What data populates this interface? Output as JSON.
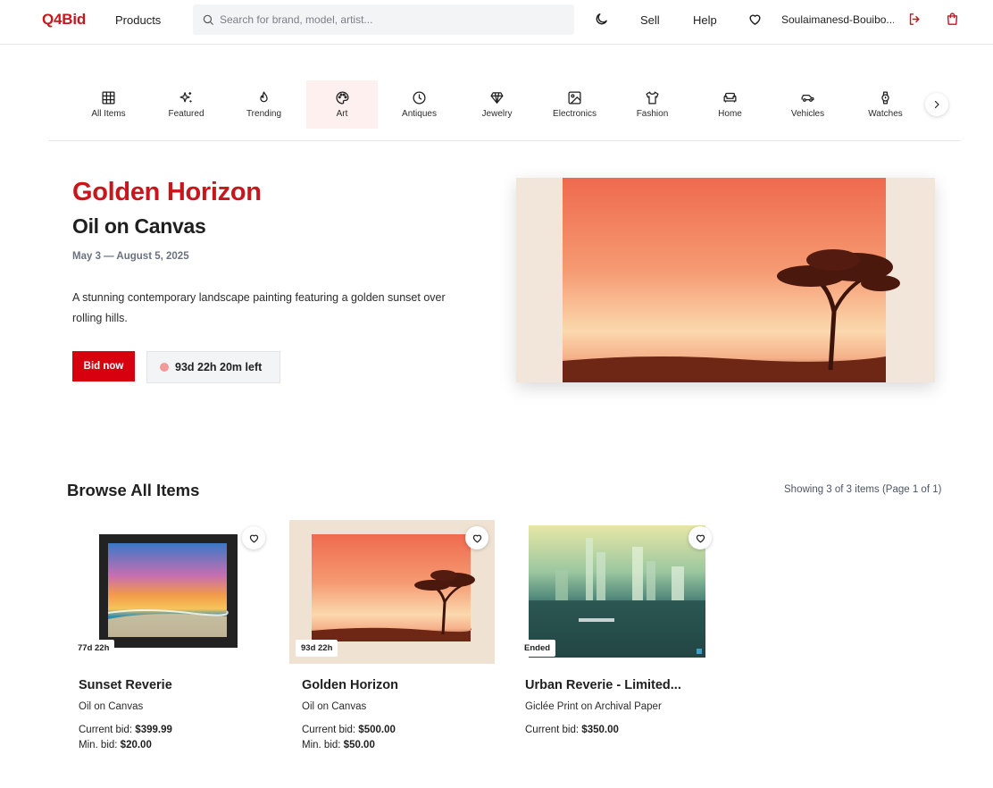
{
  "header": {
    "logo": "Q4Bid",
    "products_label": "Products",
    "search_placeholder": "Search for brand, model, artist...",
    "sell_label": "Sell",
    "help_label": "Help",
    "username": "Soulaimanesd-Bouibo...",
    "icons": [
      "search-icon",
      "moon-icon",
      "heart-icon",
      "logout-icon",
      "shopping-bag-icon"
    ]
  },
  "categories": {
    "items": [
      {
        "label": "All Items",
        "icon": "grid-icon"
      },
      {
        "label": "Featured",
        "icon": "sparkles-icon"
      },
      {
        "label": "Trending",
        "icon": "flame-icon"
      },
      {
        "label": "Art",
        "icon": "palette-icon",
        "active": true
      },
      {
        "label": "Antiques",
        "icon": "clock-icon"
      },
      {
        "label": "Jewelry",
        "icon": "gem-icon"
      },
      {
        "label": "Electronics",
        "icon": "image-icon"
      },
      {
        "label": "Fashion",
        "icon": "shirt-icon"
      },
      {
        "label": "Home",
        "icon": "sofa-icon"
      },
      {
        "label": "Vehicles",
        "icon": "car-icon"
      },
      {
        "label": "Watches",
        "icon": "watch-icon"
      }
    ],
    "next_icon": "chevron-right-icon",
    "active_bg": "#fdf0ef"
  },
  "hero": {
    "title": "Golden Horizon",
    "subtitle": "Oil on Canvas",
    "dates": "May 3 — August 5, 2025",
    "description": "A stunning contemporary landscape painting featuring a golden sunset over rolling hills.",
    "bid_button": "Bid now",
    "time_left": "93d 22h 20m left"
  },
  "browse": {
    "title": "Browse All Items",
    "count_text": "Showing 3 of 3 items (Page 1 of 1)",
    "items": [
      {
        "badge": "77d 22h",
        "title": "Sunset Reverie",
        "medium": "Oil on Canvas",
        "current_bid_label": "Current bid:",
        "current_bid": "$399.99",
        "min_bid_label": "Min. bid:",
        "min_bid": "$20.00"
      },
      {
        "badge": "93d 22h",
        "title": "Golden Horizon",
        "medium": "Oil on Canvas",
        "current_bid_label": "Current bid:",
        "current_bid": "$500.00",
        "min_bid_label": "Min. bid:",
        "min_bid": "$50.00"
      },
      {
        "badge": "Ended",
        "title": "Urban Reverie - Limited...",
        "medium": "Giclée Print on Archival Paper",
        "current_bid_label": "Current bid:",
        "current_bid": "$350.00"
      }
    ]
  },
  "colors": {
    "brand": "#c8161d",
    "bid_button": "#d7000f",
    "timer_dot": "#f29b9b"
  }
}
